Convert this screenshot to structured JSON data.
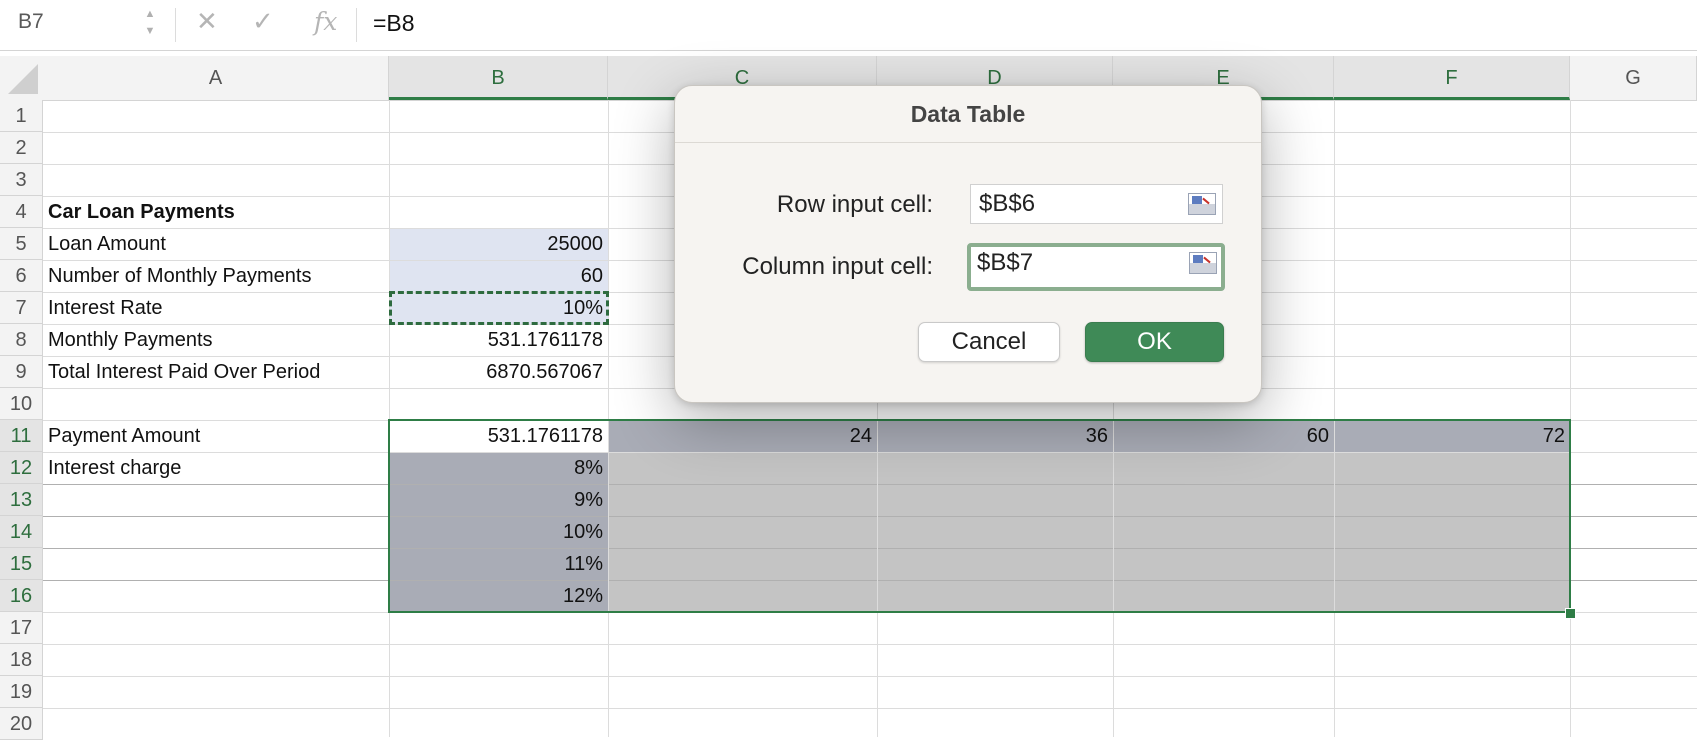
{
  "formula_bar": {
    "name_box": "B7",
    "cancel_symbol": "✕",
    "confirm_symbol": "✓",
    "fx_label": "fx",
    "formula": "=B8",
    "stepper_up": "▲",
    "stepper_down": "▼"
  },
  "columns": [
    "A",
    "B",
    "C",
    "D",
    "E",
    "F",
    "G"
  ],
  "rows": [
    "1",
    "2",
    "3",
    "4",
    "5",
    "6",
    "7",
    "8",
    "9",
    "10",
    "11",
    "12",
    "13",
    "14",
    "15",
    "16",
    "17",
    "18",
    "19",
    "20"
  ],
  "cells": {
    "A4": "Car Loan Payments",
    "A5": "Loan Amount",
    "B5": "25000",
    "A6": "Number of Monthly Payments",
    "B6": "60",
    "A7": "Interest Rate",
    "B7": "10%",
    "A8": "Monthly Payments",
    "B8": "531.1761178",
    "A9": "Total Interest Paid Over Period",
    "B9": "6870.567067",
    "A11": "Payment Amount",
    "B11": "531.1761178",
    "C11": "24",
    "D11": "36",
    "E11": "60",
    "F11": "72",
    "A12": "Interest charge",
    "B12": "8%",
    "B13": "9%",
    "B14": "10%",
    "B15": "11%",
    "B16": "12%"
  },
  "colors": {
    "accent_green": "#2e7d46",
    "ok_button": "#3f8a57",
    "input_fill": "#dfe4f1",
    "selection_fill": "#c4c4c4"
  },
  "dialog": {
    "title": "Data Table",
    "row_input_label": "Row input cell:",
    "row_input_value": "$B$6",
    "column_input_label": "Column input cell:",
    "column_input_value": "$B$7",
    "cancel_label": "Cancel",
    "ok_label": "OK",
    "collapse_icon": "range-select-icon"
  }
}
